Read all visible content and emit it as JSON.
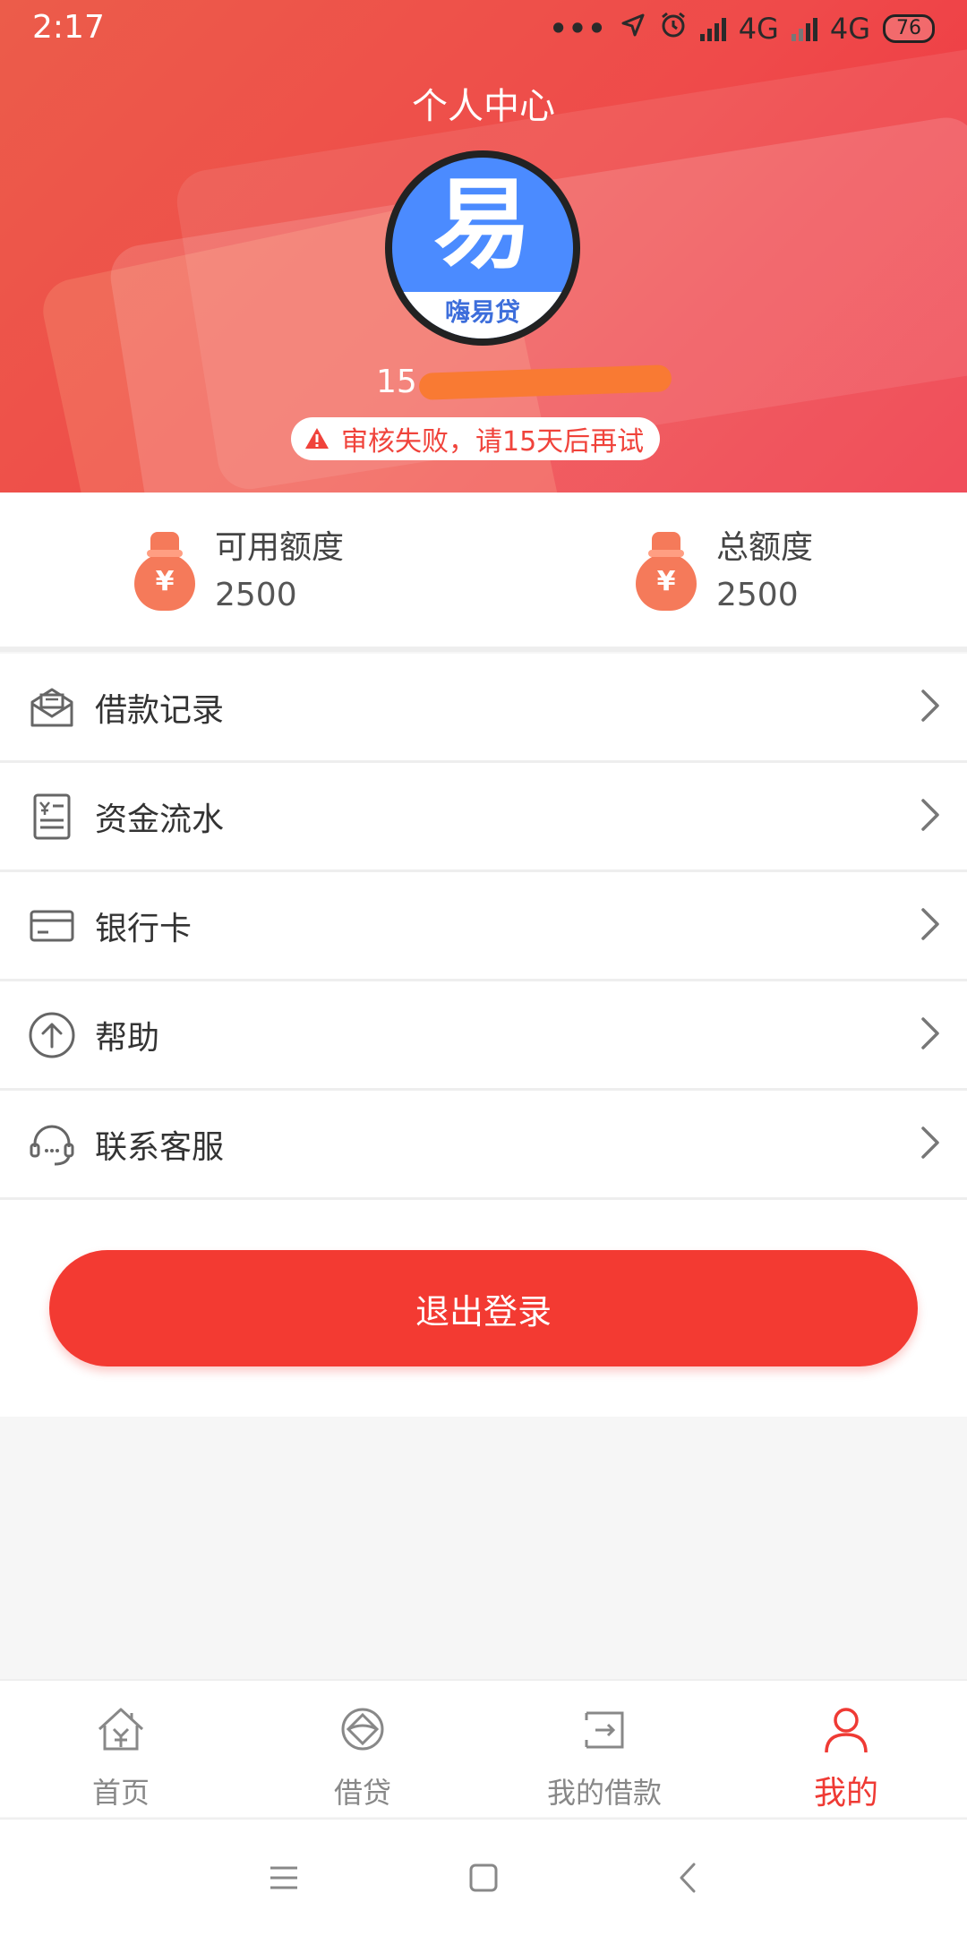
{
  "status_bar": {
    "time": "2:17",
    "network_1": "4G",
    "network_2": "4G",
    "battery": "76"
  },
  "header": {
    "title": "个人中心",
    "avatar_glyph": "易",
    "avatar_brand": "嗨易贷",
    "phone_prefix": "15",
    "notice": "审核失败，请15天后再试"
  },
  "credit": {
    "available_label": "可用额度",
    "available_value": "2500",
    "total_label": "总额度",
    "total_value": "2500"
  },
  "menu": [
    {
      "label": "借款记录",
      "icon": "envelope-icon"
    },
    {
      "label": "资金流水",
      "icon": "receipt-icon"
    },
    {
      "label": "银行卡",
      "icon": "bank-card-icon"
    },
    {
      "label": "帮助",
      "icon": "arrow-up-circle-icon"
    },
    {
      "label": "联系客服",
      "icon": "headset-icon"
    }
  ],
  "logout_label": "退出登录",
  "tabs": [
    {
      "label": "首页",
      "icon": "home-icon",
      "active": false
    },
    {
      "label": "借贷",
      "icon": "loan-icon",
      "active": false
    },
    {
      "label": "我的借款",
      "icon": "my-loans-icon",
      "active": false
    },
    {
      "label": "我的",
      "icon": "profile-icon",
      "active": true
    }
  ],
  "colors": {
    "accent": "#ef3a34",
    "header_gradient_start": "#ec5c4a",
    "header_gradient_end": "#ee3140",
    "logout_button": "#f33a32",
    "money_bag": "#f57a5a"
  }
}
